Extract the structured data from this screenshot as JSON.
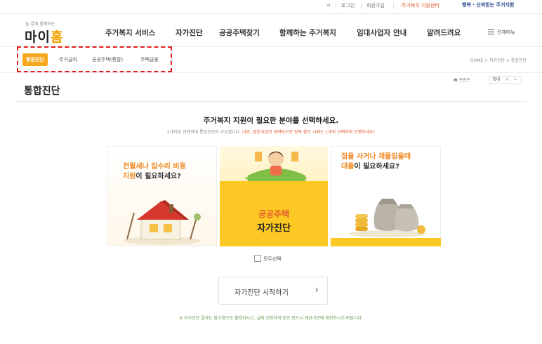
{
  "util": {
    "home": "⌂",
    "login": "로그인",
    "join": "회원가입",
    "support": "주거복지 지원센터",
    "partner": "행복 · 신뢰받는 주거지원"
  },
  "brand": {
    "tagline": "늘 곁에 함께하는",
    "name_main": "마이",
    "name_accent": "홈"
  },
  "gnb": [
    "주거복지 서비스",
    "자가진단",
    "공공주택찾기",
    "함께하는 주거복지",
    "임대사업자 안내",
    "알려드려요"
  ],
  "all_menu": "전체메뉴",
  "subnav": {
    "tabs": [
      "통합진단",
      "주거급여",
      "공공주택(통합)",
      "주택금융"
    ],
    "breadcrumb": "HOME > 자가진단 > 통합진단"
  },
  "page": {
    "title": "통합진단",
    "print": "프린트",
    "zoom": [
      "확대",
      "+",
      "−"
    ],
    "headline": "주거복지 지원이 필요한 분야를 선택하세요.",
    "sub_note": "2개이상 선택하여 통합진단이 가능합니다.",
    "sub_warn": "다만, 정운사업의 생략되므로 항목 참조 시에는 1개씩 선택하여 진행하세요!"
  },
  "cards": [
    {
      "line1_orange": "전월세나 집수리 비용",
      "line2_orange": "지원",
      "line2_rest": "이 필요하세요?"
    },
    {
      "title_top": "공공주택",
      "title_bottom": "자가진단"
    },
    {
      "line1_orange": "집을 사거나 채물입을때",
      "line2_orange": "대출",
      "line2_rest": "이 필요하세요?"
    }
  ],
  "select_all": "모두선택",
  "start_button": "자가진단 시작하기",
  "chevron": "›",
  "footnote": "※ 자가진단 결과는 참고용으로 활용하시고, 실제 신청자격 등은 반드시 해당기관에 확인하시기 바랍니다.",
  "colors": {
    "accent": "#f6a81d",
    "card_yellow": "#fcc823",
    "highlight_box": "#e21b1b",
    "orange_text": "#f08a24"
  }
}
